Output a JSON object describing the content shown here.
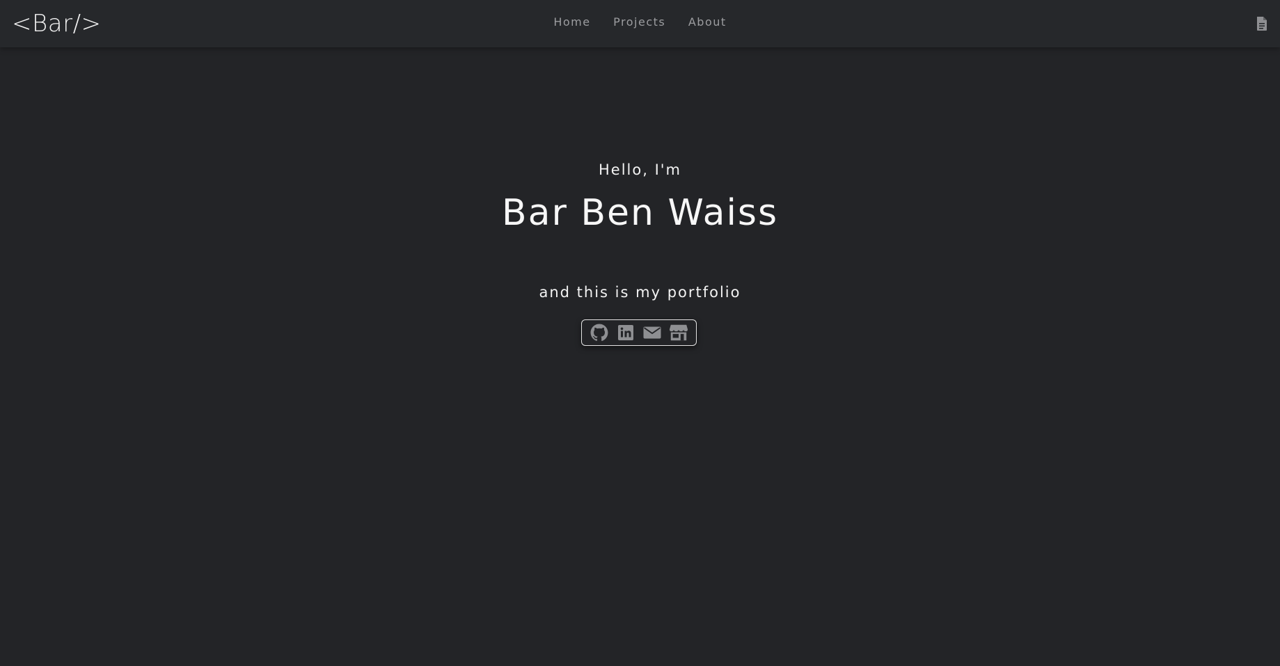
{
  "header": {
    "brand": "<Bar/>",
    "nav": [
      {
        "label": "Home"
      },
      {
        "label": "Projects"
      },
      {
        "label": "About"
      }
    ],
    "resume_icon": "file-document-icon"
  },
  "hero": {
    "greeting": "Hello, I'm",
    "name": "Bar Ben Waiss",
    "tagline": "and this is my portfolio"
  },
  "socials": [
    {
      "icon": "github-icon"
    },
    {
      "icon": "linkedin-icon"
    },
    {
      "icon": "email-icon"
    },
    {
      "icon": "store-icon"
    }
  ],
  "colors": {
    "background": "#232427",
    "navbar": "#26282b",
    "nav_text": "#9c9da0",
    "icon": "#8e8f92",
    "text": "#f3f3f3"
  }
}
